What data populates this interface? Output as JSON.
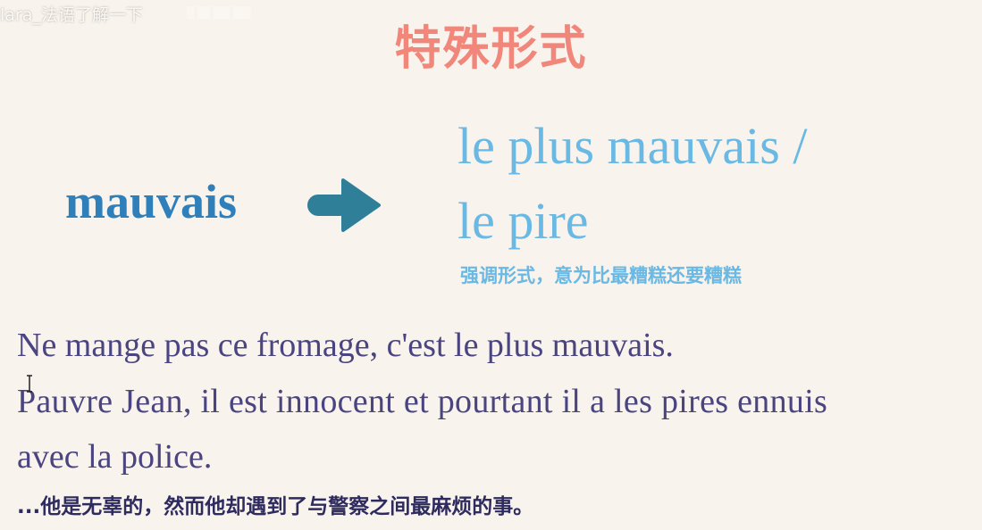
{
  "watermark": {
    "text": "lara_法语了解一下"
  },
  "slide": {
    "title": "特殊形式",
    "word": "mauvais",
    "superlative_line1": "le plus mauvais /",
    "superlative_line2": "le pire",
    "note": "强调形式，意为比最糟糕还要糟糕",
    "examples": [
      "Ne mange pas ce fromage, c'est le plus mauvais.",
      "Pauvre Jean, il est innocent et pourtant il a les pires ennuis",
      "avec la police."
    ]
  },
  "subtitle": "...他是无辜的，然而他却遇到了与警察之间最麻烦的事。",
  "colors": {
    "background": "#f8f3ec",
    "title": "#f0877a",
    "word": "#2f7fba",
    "arrow": "#2f7f98",
    "superlative": "#6ab8e4",
    "example_text": "#4a4580",
    "subtitle": "#2e2b5e"
  },
  "icons": {
    "arrow": "right-arrow-icon",
    "cursor": "text-cursor-icon",
    "logo": "platform-logo-icon"
  }
}
